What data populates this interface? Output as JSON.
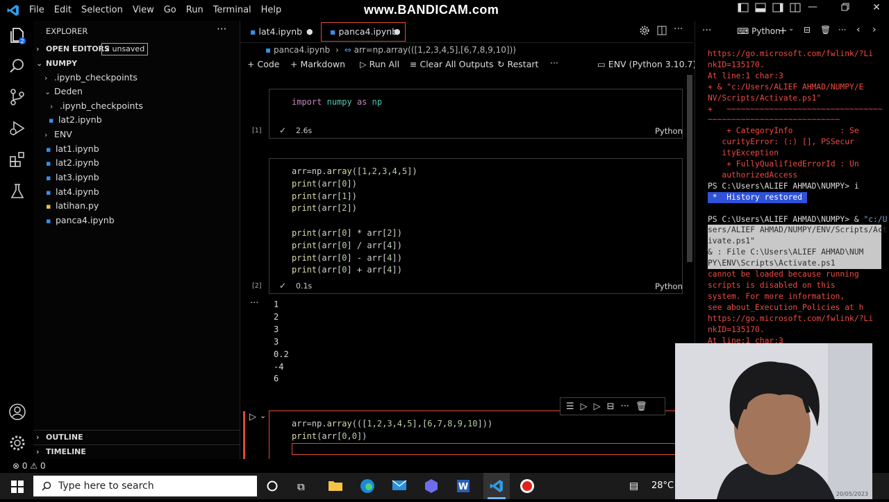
{
  "titlebar": {
    "menu": [
      "File",
      "Edit",
      "Selection",
      "View",
      "Go",
      "Run",
      "Terminal",
      "Help"
    ],
    "watermark": "www.BANDICAM.com"
  },
  "explorer": {
    "title": "EXPLORER",
    "open_editors": "OPEN EDITORS",
    "unsaved_badge": "2 unsaved",
    "folder": "NUMPY",
    "items": [
      {
        "label": ".ipynb_checkpoints",
        "kind": "folder"
      },
      {
        "label": "Deden",
        "kind": "folder-open"
      },
      {
        "label": ".ipynb_checkpoints",
        "kind": "folder"
      },
      {
        "label": "lat2.ipynb",
        "kind": "file"
      },
      {
        "label": "ENV",
        "kind": "folder"
      },
      {
        "label": "lat1.ipynb",
        "kind": "file"
      },
      {
        "label": "lat2.ipynb",
        "kind": "file"
      },
      {
        "label": "lat3.ipynb",
        "kind": "file"
      },
      {
        "label": "lat4.ipynb",
        "kind": "file"
      },
      {
        "label": "latihan.py",
        "kind": "python"
      },
      {
        "label": "panca4.ipynb",
        "kind": "file"
      }
    ],
    "outline": "OUTLINE",
    "timeline": "TIMELINE"
  },
  "tabs": [
    {
      "label": "lat4.ipynb"
    },
    {
      "label": "panca4.ipynb"
    }
  ],
  "breadcrumb": {
    "file": "panca4.ipynb",
    "cell": "arr=np.array(([1,2,3,4,5],[6,7,8,9,10]))"
  },
  "toolbar": {
    "code": "Code",
    "markdown": "Markdown",
    "run_all": "Run All",
    "clear": "Clear All Outputs",
    "restart": "Restart",
    "more": "···",
    "kernel": "ENV (Python 3.10.7)"
  },
  "cells": [
    {
      "index": "[1]",
      "time": "2.6s",
      "lang": "Python"
    },
    {
      "index": "[2]",
      "time": "0.1s",
      "lang": "Python",
      "outputs": [
        "1",
        "2",
        "3",
        "3",
        "0.2",
        "-4",
        "6"
      ]
    }
  ],
  "statusbar": {
    "errors": "0",
    "warnings": "0"
  },
  "terminal": {
    "shell": "Python",
    "lines": [
      "https://go.microsoft.com/fwlink/?Li",
      "nkID=135170.",
      "At line:1 char:3",
      "+ & \"c:/Users/ALIEF AHMAD/NUMPY/E",
      "NV/Scripts/Activate.ps1\"",
      "+   ~~~~~~~~~~~~~~~~~~~~~~~~~~~~~~~~~",
      "~~~~~~~~~~~~~~~~~~~~~~~~~~~~",
      "    + CategoryInfo          : Se",
      "   curityError: (:) [], PSSecur",
      "   ityException",
      "    + FullyQualifiedErrorId : Un",
      "   authorizedAccess"
    ],
    "prompt1": "PS C:\\Users\\ALIEF AHMAD\\NUMPY> i",
    "history": " *  History restored ",
    "prompt2": "PS C:\\Users\\ALIEF AHMAD\\NUMPY> & ",
    "cmd_first": "\"c:/U",
    "hl_lines": [
      "sers/ALIEF AHMAD/NUMPY/ENV/Scripts/Act",
      "ivate.ps1\"",
      "& : File C:\\Users\\ALIEF AHMAD\\NUM",
      "PY\\ENV\\Scripts\\Activate.ps1"
    ],
    "err_lines": [
      "cannot be loaded because running",
      "scripts is disabled on this",
      "system. For more information,",
      "see about_Execution_Policies at h",
      "https://go.microsoft.com/fwlink/?Li",
      "nkID=135170.",
      "At line:1 char:3"
    ]
  },
  "taskbar": {
    "search": "Type here to search",
    "weather": "28°C",
    "date": "20/05/2023"
  },
  "colors": {
    "accent": "#0a84ff",
    "error": "#ee4b40",
    "modified_tab_border": "#e2483c"
  }
}
